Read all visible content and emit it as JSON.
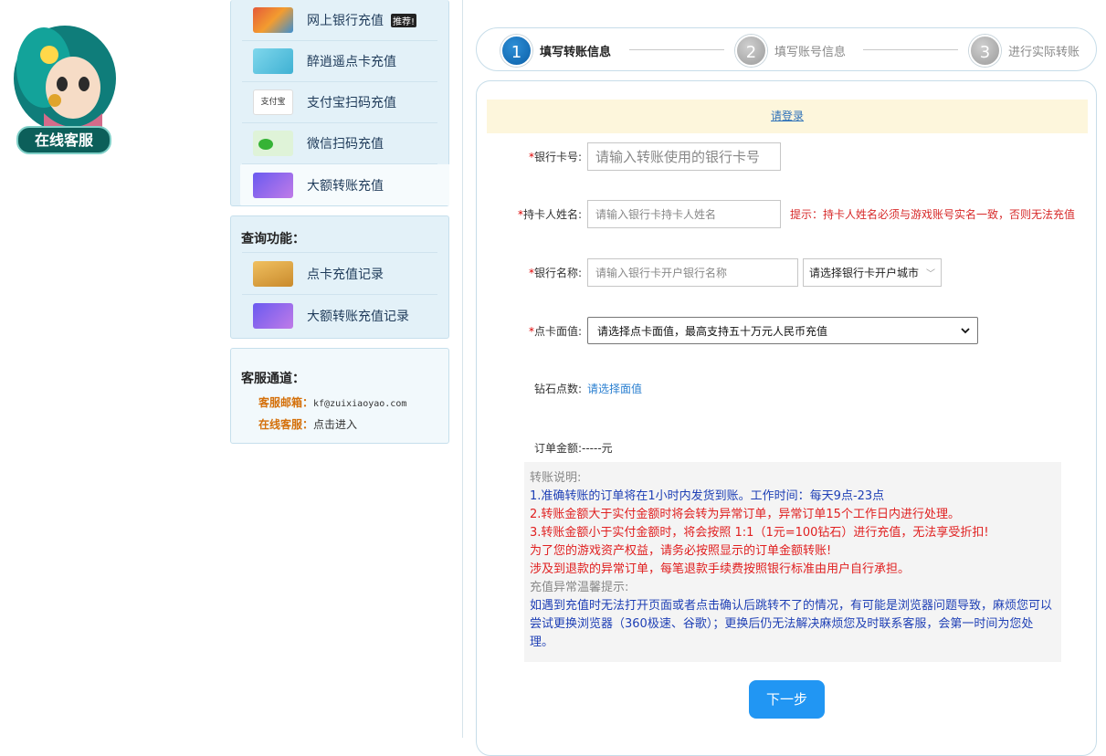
{
  "mascot": {
    "badge": "在线客服",
    "icon": "customer-service-mascot"
  },
  "sidebar": {
    "recharge_items": [
      {
        "label": "网上银行充值",
        "icon": "unionpay-card-icon",
        "tag": "推荐!",
        "active": false
      },
      {
        "label": "醉逍遥点卡充值",
        "icon": "game-card-icon",
        "active": false
      },
      {
        "label": "支付宝扫码充值",
        "icon": "alipay-icon",
        "active": false
      },
      {
        "label": "微信扫码充值",
        "icon": "wechat-pay-icon",
        "active": false
      },
      {
        "label": "大额转账充值",
        "icon": "transfer-card-icon",
        "active": true
      }
    ],
    "query": {
      "title": "查询功能：",
      "items": [
        {
          "label": "点卡充值记录",
          "icon": "card-records-icon"
        },
        {
          "label": "大额转账充值记录",
          "icon": "transfer-records-icon"
        }
      ]
    },
    "service": {
      "title": "客服通道：",
      "email_key": "客服邮箱：",
      "email_val": "kf@zuixiaoyao.com",
      "online_key": "在线客服：",
      "online_val": "点击进入"
    }
  },
  "steps": [
    {
      "num": "1",
      "label": "填写转账信息",
      "active": true
    },
    {
      "num": "2",
      "label": "填写账号信息",
      "active": false
    },
    {
      "num": "3",
      "label": "进行实际转账",
      "active": false
    }
  ],
  "form": {
    "login_link": "请登录",
    "bank_card": {
      "label": "银行卡号:",
      "placeholder": "请输入转账使用的银行卡号"
    },
    "holder_name": {
      "label": "持卡人姓名:",
      "placeholder": "请输入银行卡持卡人姓名",
      "hint": "提示：持卡人姓名必须与游戏账号实名一致，否则无法充值"
    },
    "bank_name": {
      "label": "银行名称:",
      "placeholder": "请输入银行卡开户银行名称",
      "city_select": "请选择银行卡开户城市"
    },
    "amount": {
      "label": "点卡面值:",
      "selected": "请选择点卡面值，最高支持五十万元人民币充值"
    },
    "diamonds": {
      "label": "钻石点数:",
      "value": "请选择面值"
    },
    "order": {
      "label": "订单金额:",
      "value": "-----元"
    }
  },
  "notes": {
    "title": "转账说明:",
    "lines": [
      "1.准确转账的订单将在1小时内发货到账。工作时间：每天9点-23点",
      "2.转账金额大于实付金额时将会转为异常订单，异常订单15个工作日内进行处理。",
      "3.转账金额小于实付金额时，将会按照 1:1（1元=100钻石）进行充值，无法享受折扣!",
      "为了您的游戏资产权益，请务必按照显示的订单金额转账!",
      "涉及到退款的异常订单，每笔退款手续费按照银行标准由用户自行承担。"
    ],
    "warm_title": "充值异常温馨提示:",
    "warm_text": "如遇到充值时无法打开页面或者点击确认后跳转不了的情况，有可能是浏览器问题导致，麻烦您可以尝试更换浏览器（360极速、谷歌）；更换后仍无法解决麻烦您及时联系客服，会第一时间为您处理。"
  },
  "next_button": "下一步",
  "colors": {
    "primary": "#2196f3",
    "sidebar_bg": "#e3f1f8",
    "warning": "#d72a2a",
    "notice_bg": "#fdf6dc"
  }
}
